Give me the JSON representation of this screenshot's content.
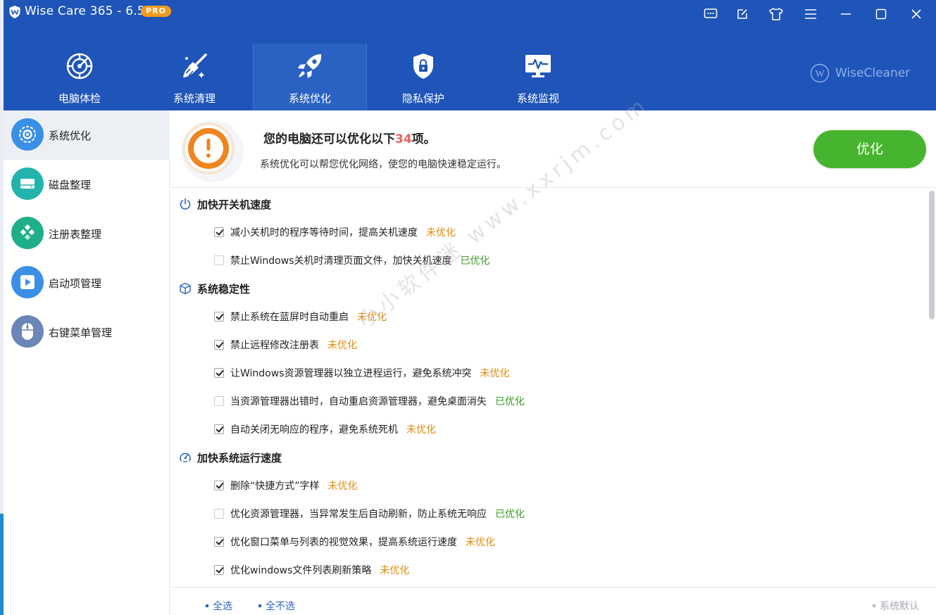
{
  "window": {
    "title": "Wise Care 365 - 6.5.1",
    "badge": "PRO",
    "controls": [
      "feedback-icon",
      "edit-icon",
      "skin-icon",
      "menu-icon",
      "minimize-icon",
      "maximize-icon",
      "close-icon"
    ]
  },
  "tabs": [
    {
      "label": "电脑体检",
      "icon": "radar-icon"
    },
    {
      "label": "系统清理",
      "icon": "broom-icon"
    },
    {
      "label": "系统优化",
      "icon": "rocket-icon",
      "active": true
    },
    {
      "label": "隐私保护",
      "icon": "shield-lock-icon"
    },
    {
      "label": "系统监视",
      "icon": "monitor-icon"
    }
  ],
  "brand": {
    "name": "WiseCleaner",
    "logo": "W"
  },
  "sidebar": {
    "items": [
      {
        "label": "系统优化",
        "icon": "gear-icon",
        "color": "#3a8fe6",
        "active": true
      },
      {
        "label": "磁盘整理",
        "icon": "disk-icon",
        "color": "#22b3ad"
      },
      {
        "label": "注册表整理",
        "icon": "registry-icon",
        "color": "#1fae8a"
      },
      {
        "label": "启动项管理",
        "icon": "play-icon",
        "color": "#3a8fe6"
      },
      {
        "label": "右键菜单管理",
        "icon": "mouse-icon",
        "color": "#6a85b6"
      }
    ]
  },
  "banner": {
    "title_prefix": "您的电脑还可以优化以下",
    "count": "34",
    "title_suffix": "项。",
    "subtitle": "系统优化可以帮您优化网络，使您的电脑快速稳定运行。",
    "optimize_button": "优化",
    "icon": "warning-icon"
  },
  "sections": [
    {
      "title": "加快开关机速度",
      "icon": "power-icon",
      "items": [
        {
          "text": "减小关机时的程序等待时间，提高关机速度",
          "checked": true,
          "status": "未优化",
          "state": "pending"
        },
        {
          "text": "禁止Windows关机时清理页面文件，加快关机速度",
          "checked": false,
          "status": "已优化",
          "state": "done"
        }
      ]
    },
    {
      "title": "系统稳定性",
      "icon": "cube-icon",
      "items": [
        {
          "text": "禁止系统在蓝屏时自动重启",
          "checked": true,
          "status": "未优化",
          "state": "pending"
        },
        {
          "text": "禁止远程修改注册表",
          "checked": true,
          "status": "未优化",
          "state": "pending"
        },
        {
          "text": "让Windows资源管理器以独立进程运行，避免系统冲突",
          "checked": true,
          "status": "未优化",
          "state": "pending"
        },
        {
          "text": "当资源管理器出错时，自动重启资源管理器，避免桌面消失",
          "checked": false,
          "status": "已优化",
          "state": "done"
        },
        {
          "text": "自动关闭无响应的程序，避免系统死机",
          "checked": true,
          "status": "未优化",
          "state": "pending"
        }
      ]
    },
    {
      "title": "加快系统运行速度",
      "icon": "speedometer-icon",
      "items": [
        {
          "text": "删除“快捷方式”字样",
          "checked": true,
          "status": "未优化",
          "state": "pending"
        },
        {
          "text": "优化资源管理器，当异常发生后自动刷新，防止系统无响应",
          "checked": false,
          "status": "已优化",
          "state": "done"
        },
        {
          "text": "优化窗口菜单与列表的视觉效果，提高系统运行速度",
          "checked": true,
          "status": "未优化",
          "state": "pending"
        },
        {
          "text": "优化windows文件列表刷新策略",
          "checked": true,
          "status": "未优化",
          "state": "pending"
        }
      ]
    }
  ],
  "footer": {
    "select_all": "全选",
    "select_none": "全不选",
    "system_default": "系统默认"
  },
  "watermark": "小小软件迷 www.xxrjm.com"
}
